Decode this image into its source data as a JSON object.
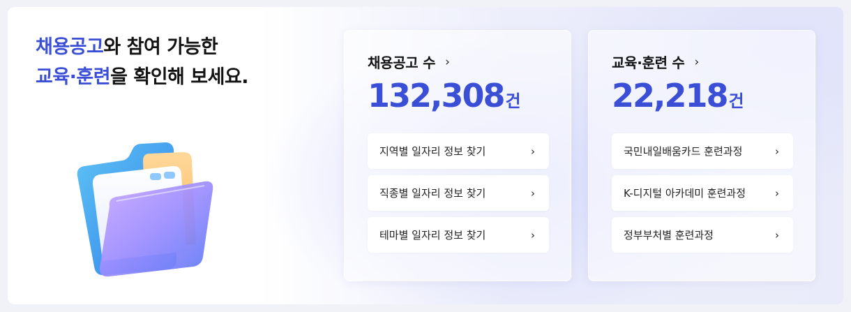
{
  "headline": {
    "line1_highlight": "채용공고",
    "line1_rest": "와 참여 가능한",
    "line2_highlight": "교육·훈련",
    "line2_rest": "을 확인해 보세요."
  },
  "jobs_card": {
    "title": "채용공고 수",
    "chevron": "›",
    "count": "132,308",
    "unit": "건",
    "links": [
      {
        "label": "지역별 일자리 정보 찾기",
        "arrow": "›"
      },
      {
        "label": "직종별 일자리 정보 찾기",
        "arrow": "›"
      },
      {
        "label": "테마별 일자리 정보 찾기",
        "arrow": "›"
      }
    ]
  },
  "training_card": {
    "title": "교육·훈련 수",
    "chevron": "›",
    "count": "22,218",
    "unit": "건",
    "links": [
      {
        "label": "국민내일배움카드 훈련과정",
        "arrow": "›"
      },
      {
        "label": "K-디지털 아카데미 훈련과정",
        "arrow": "›"
      },
      {
        "label": "정부부처별 훈련과정",
        "arrow": "›"
      }
    ]
  },
  "colors": {
    "accent": "#3b4fd6",
    "text": "#121212",
    "card_bg": "#ffffff"
  },
  "icons": {
    "illustration": "folder-icon",
    "link_arrow": "chevron-right-icon"
  }
}
